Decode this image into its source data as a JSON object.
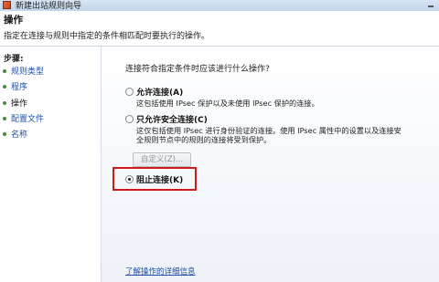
{
  "window": {
    "title": "新建出站规则向导"
  },
  "header": {
    "title": "操作",
    "description": "指定在连接与规则中指定的条件相匹配时要执行的操作。"
  },
  "steps": {
    "heading": "步骤:",
    "items": [
      {
        "label": "规则类型"
      },
      {
        "label": "程序"
      },
      {
        "label": "操作"
      },
      {
        "label": "配置文件"
      },
      {
        "label": "名称"
      }
    ]
  },
  "main": {
    "question": "连接符合指定条件时应该进行什么操作?",
    "options": [
      {
        "label": "允许连接(A)",
        "description": "这包括使用 IPsec 保护以及未使用 IPsec 保护的连接。",
        "selected": false
      },
      {
        "label": "只允许安全连接(C)",
        "description_line1": "这仅包括使用 IPsec 进行身份验证的连接。使用 IPsec 属性中的设置以及连接安",
        "description_line2": "全规则节点中的规则的连接将受到保护。",
        "selected": false
      },
      {
        "label": "阻止连接(K)",
        "selected": true
      }
    ],
    "custom_button": "自定义(Z)...",
    "learn_link": "了解操作的详细信息"
  },
  "colors": {
    "highlight": "#d01a1a",
    "link": "#1f4fa8",
    "step_dot": "#4a8c3f"
  }
}
